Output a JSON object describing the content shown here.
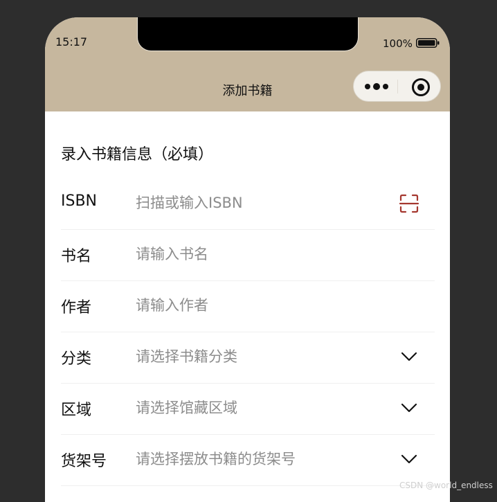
{
  "status_bar": {
    "time": "15:17",
    "battery": "100%"
  },
  "nav": {
    "title": "添加书籍"
  },
  "capsule": {
    "more_icon": "more-dots-icon",
    "close_icon": "target-circle-icon"
  },
  "form": {
    "section_title": "录入书籍信息（必填）",
    "fields": [
      {
        "label": "ISBN",
        "placeholder": "扫描或输入ISBN",
        "icon": "scan-icon"
      },
      {
        "label": "书名",
        "placeholder": "请输入书名"
      },
      {
        "label": "作者",
        "placeholder": "请输入作者"
      },
      {
        "label": "分类",
        "placeholder": "请选择书籍分类",
        "icon": "chevron-down-icon"
      },
      {
        "label": "区域",
        "placeholder": "请选择馆藏区域",
        "icon": "chevron-down-icon"
      },
      {
        "label": "货架号",
        "placeholder": "请选择摆放书籍的货架号",
        "icon": "chevron-down-icon"
      }
    ]
  },
  "colors": {
    "header_bg": "#c6b79e",
    "scan_accent": "#a5372f",
    "page_bg": "#2d2d2d"
  },
  "watermark": "CSDN @world_endless"
}
